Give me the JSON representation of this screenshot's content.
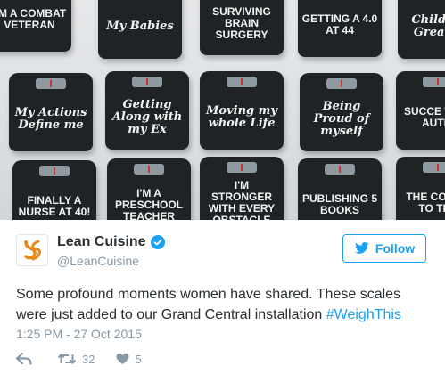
{
  "photo": {
    "scales": [
      {
        "text": "I'm a Combat Veteran",
        "caps": true
      },
      {
        "text": "My Babies",
        "caps": false
      },
      {
        "text": "Surviving Brain Surgery",
        "caps": true
      },
      {
        "text": "Getting a 4.0 at 44",
        "caps": true
      },
      {
        "text": "Children Greatne",
        "caps": false
      },
      {
        "text": "My Actions Define me",
        "caps": false
      },
      {
        "text": "Getting Along with my Ex",
        "caps": false
      },
      {
        "text": "Moving my whole Life",
        "caps": false
      },
      {
        "text": "Being Proud of myself",
        "caps": false
      },
      {
        "text": "Succe with Autis",
        "caps": true
      },
      {
        "text": "Finally a Nurse at 40!",
        "caps": true
      },
      {
        "text": "I'm a Preschool Teacher",
        "caps": true
      },
      {
        "text": "I'm Stronger with Every Obstacle",
        "caps": true
      },
      {
        "text": "Publishing 5 Books",
        "caps": true
      },
      {
        "text": "The Coura to try",
        "caps": true
      }
    ]
  },
  "tweet": {
    "display_name": "Lean Cuisine",
    "handle": "@LeanCuisine",
    "follow_label": "Follow",
    "text": "Some profound moments women have shared. These scales were just added to our Grand Central installation ",
    "hashtag": "#WeighThis",
    "timestamp": "1:25 PM - 27 Oct 2015",
    "retweet_count": "32",
    "like_count": "5",
    "colors": {
      "accent": "#1da1f2",
      "muted": "#8899a6",
      "text": "#292f33",
      "brand_orange": "#e8891c"
    }
  }
}
